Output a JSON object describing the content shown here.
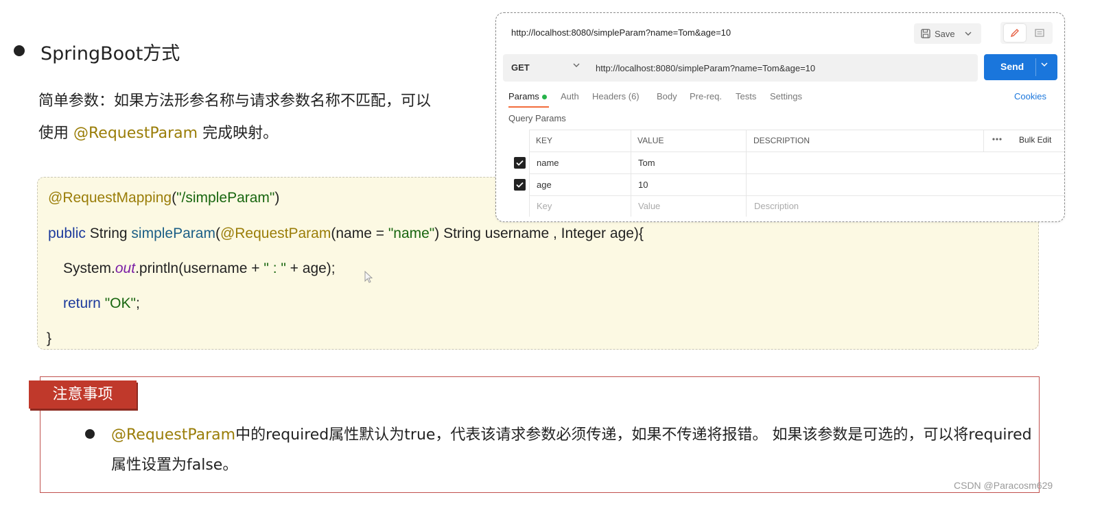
{
  "slide": {
    "heading": "SpringBoot方式",
    "desc_line1": "简单参数：如果方法形参名称与请求参数名称不匹配，可以",
    "desc_line2_prefix": "使用 ",
    "desc_line2_accent": "@RequestParam",
    "desc_line2_suffix": " 完成映射。"
  },
  "code": {
    "l1_ann": "@RequestMapping",
    "l1_paren_open": "(",
    "l1_str": "\"/simpleParam\"",
    "l1_paren_close": ")",
    "l2_kw": "public",
    "l2_type": " String ",
    "l2_fn": "simpleParam",
    "l2_paren": "(",
    "l2_ann": "@RequestParam",
    "l2_arg": "(name = ",
    "l2_str": "\"name\"",
    "l2_rest": ") String username , Integer age){",
    "l3_pre": "System.",
    "l3_it": "out",
    "l3_mid": ".println(username + ",
    "l3_str": "\" : \"",
    "l3_post": " + age);",
    "l4_kw": "return ",
    "l4_str": "\"OK\"",
    "l4_end": ";",
    "l5": "}"
  },
  "note": {
    "tag": "注意事项",
    "accent": "@RequestParam",
    "text_rest": "中的required属性默认为true，代表该请求参数必须传递，如果不传递将报错。 如果该参数是可选的，可以将required属性设置为false。"
  },
  "postman": {
    "title_url": "http://localhost:8080/simpleParam?name=Tom&age=10",
    "save_label": "Save",
    "method": "GET",
    "url": "http://localhost:8080/simpleParam?name=Tom&age=10",
    "send_label": "Send",
    "tabs": [
      "Params",
      "Auth",
      "Headers (6)",
      "Body",
      "Pre-req.",
      "Tests",
      "Settings"
    ],
    "cookies_label": "Cookies",
    "query_params_label": "Query Params",
    "columns": [
      "KEY",
      "VALUE",
      "DESCRIPTION"
    ],
    "bulk_edit_label": "Bulk Edit",
    "rows": [
      {
        "key": "name",
        "value": "Tom",
        "description": "",
        "checked": true
      },
      {
        "key": "age",
        "value": "10",
        "description": "",
        "checked": true
      }
    ],
    "placeholders": {
      "key": "Key",
      "value": "Value",
      "description": "Description"
    },
    "colors": {
      "send": "#1a76dc",
      "tab_underline": "#f26b3a",
      "params_dot": "#26b34a"
    }
  },
  "watermark": "CSDN @Paracosm629",
  "colors": {
    "accent_text": "#9a7d08",
    "note_tag": "#c0392b",
    "note_border": "#c0504d",
    "code_bg": "#fcf9e3"
  }
}
